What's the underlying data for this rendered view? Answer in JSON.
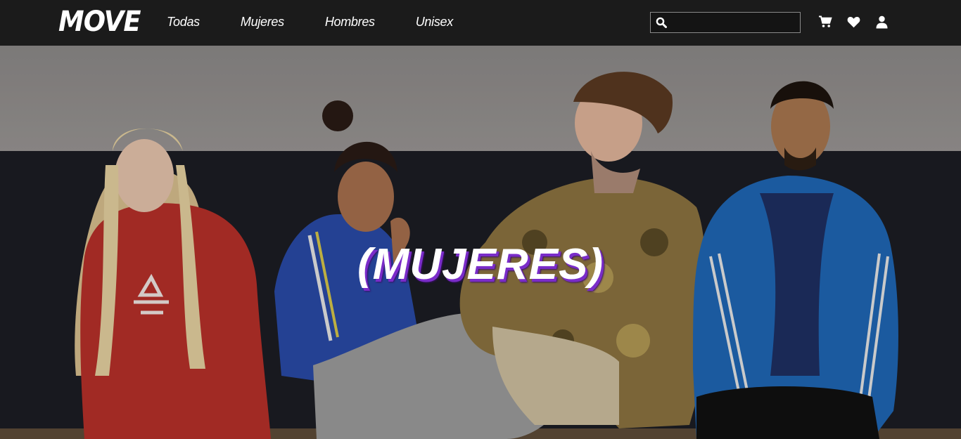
{
  "brand": {
    "logo_text": "MOVE"
  },
  "nav": {
    "links": [
      {
        "label": "Todas"
      },
      {
        "label": "Mujeres"
      },
      {
        "label": "Hombres"
      },
      {
        "label": "Unisex"
      }
    ]
  },
  "search": {
    "value": "",
    "placeholder": "",
    "icon": "search-icon"
  },
  "header_icons": [
    "cart-icon",
    "heart-icon",
    "user-icon"
  ],
  "hero": {
    "title": "(MUJERES)",
    "image": "group-photo-four-models-in-sportswear"
  },
  "colors": {
    "navbar": "#1b1b1b",
    "title_shadow": "#7a2cc9",
    "text": "#ffffff"
  }
}
